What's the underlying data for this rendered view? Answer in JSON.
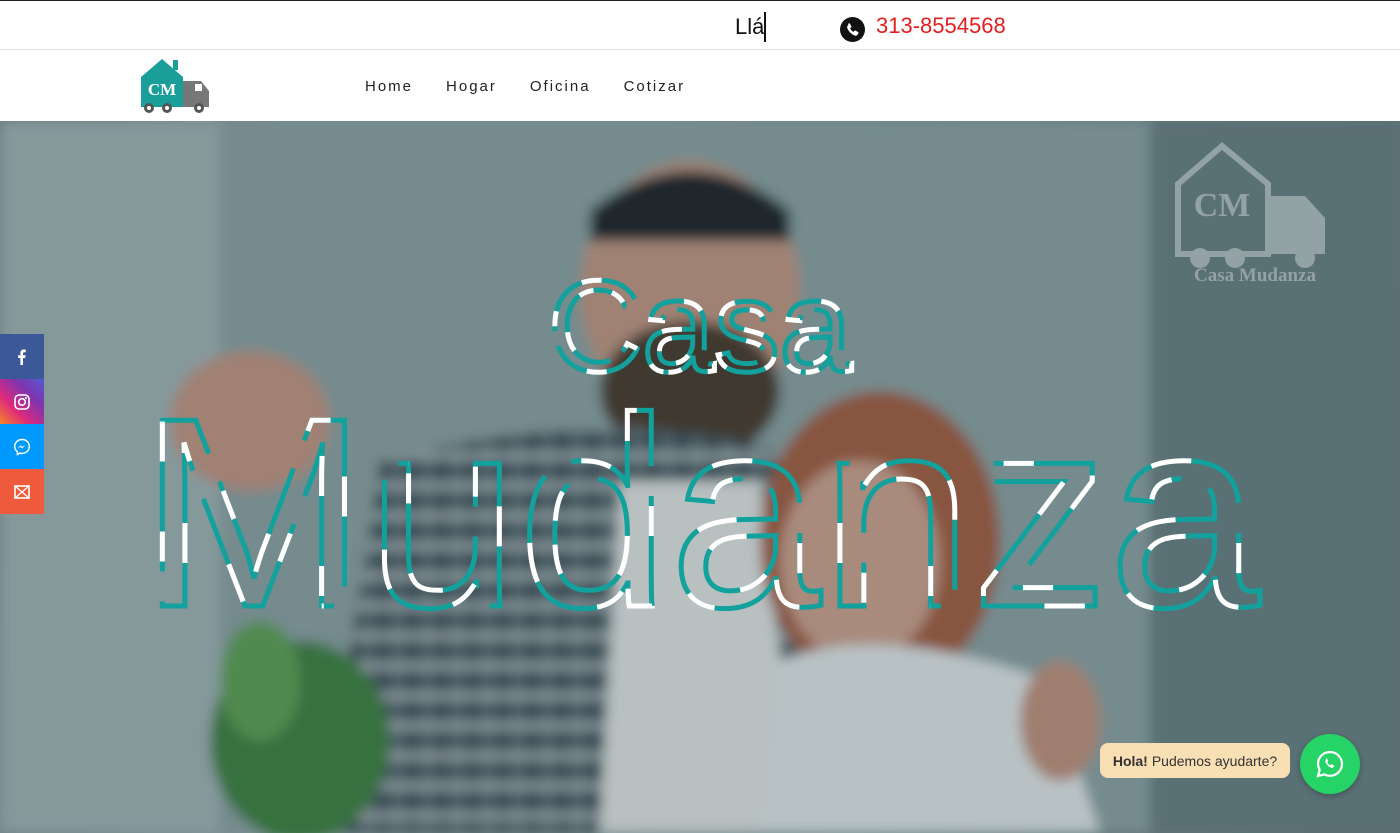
{
  "topbar": {
    "typing_text": "Llá",
    "phone_icon": "phone-icon",
    "phone_number": "313-8554568",
    "phone_color": "#e41e1e"
  },
  "logo": {
    "initials": "CM",
    "icon": "house-truck-logo",
    "color": "#1a9e9a"
  },
  "nav": {
    "items": [
      {
        "label": "Home"
      },
      {
        "label": "Hogar"
      },
      {
        "label": "Oficina"
      },
      {
        "label": "Cotizar"
      }
    ]
  },
  "hero": {
    "title_line1": "Casa",
    "title_line2": "Mudanza",
    "accent_color": "#12a19c",
    "watermark": {
      "initials": "CM",
      "text": "Casa Mudanza"
    }
  },
  "social": [
    {
      "name": "facebook",
      "icon": "facebook-icon",
      "color": "#3b5998"
    },
    {
      "name": "instagram",
      "icon": "instagram-icon",
      "color": "#c13584"
    },
    {
      "name": "messenger",
      "icon": "messenger-icon",
      "color": "#0099ff"
    },
    {
      "name": "email",
      "icon": "email-icon",
      "color": "#f05a3c"
    }
  ],
  "chat": {
    "bold": "Hola!",
    "text": "Pudemos ayudarte?",
    "button_icon": "whatsapp-icon",
    "button_color": "#25d366"
  }
}
